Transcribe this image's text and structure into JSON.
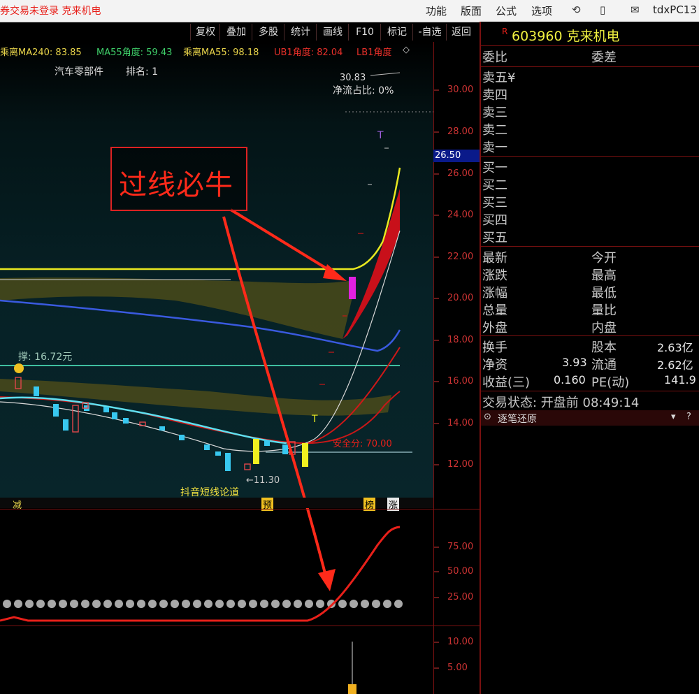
{
  "menubar": {
    "status": "券交易未登录  克来机电",
    "items": [
      "功能",
      "版面",
      "公式",
      "选项"
    ],
    "user": "tdxPC13"
  },
  "toolbar": {
    "buttons": [
      "复权",
      "叠加",
      "多股",
      "统计",
      "画线",
      "F10",
      "标记",
      "-自选",
      "返回"
    ]
  },
  "indicators": {
    "ma240": "乘离MA240: 83.85",
    "ma55_angle": "MA55角度: 59.43",
    "ma55": "乘离MA55: 98.18",
    "ub1": "UB1角度: 82.04",
    "lb1": "LB1角度"
  },
  "chart_info": {
    "sector": "汽车零部件",
    "rank": "排名: 1",
    "net_flow_value": "30.83",
    "net_flow": "净流占比: 0%",
    "support": "撑: 16.72元",
    "safe_score": "安全分: 70.00",
    "low_price": "←11.30",
    "watermark": "抖音短线论道",
    "annotation": "过线必牛",
    "signals": [
      "减",
      "预",
      "榜",
      "涨",
      "T",
      "T"
    ]
  },
  "price_axis": [
    "30.00",
    "28.00",
    "26.00",
    "24.00",
    "22.00",
    "20.00",
    "18.00",
    "16.00",
    "14.00",
    "12.00"
  ],
  "current_price": "26.50",
  "sub_axis1": [
    "75.00",
    "50.00",
    "25.00"
  ],
  "sub_axis2": [
    "10.00",
    "5.00"
  ],
  "quote": {
    "code_name": "603960 克来机电",
    "marker": "R",
    "labels": {
      "weibi": "委比",
      "weicha": "委差",
      "sell": [
        "卖五¥",
        "卖四",
        "卖三",
        "卖二",
        "卖一"
      ],
      "buy": [
        "买一",
        "买二",
        "买三",
        "买四",
        "买五"
      ],
      "zuixin": "最新",
      "jinkai": "今开",
      "zhangdie": "涨跌",
      "zuigao": "最高",
      "zhangfu": "涨幅",
      "zuidi": "最低",
      "zongliang": "总量",
      "liangbi": "量比",
      "waipan": "外盘",
      "neipan": "内盘",
      "huanshou": "换手",
      "guben": "股本",
      "jingzi": "净资",
      "liutong": "流通",
      "shouyi": "收益(三)",
      "pe": "PE(动)"
    },
    "values": {
      "guben": "2.63亿",
      "jingzi": "3.93",
      "liutong": "2.62亿",
      "shouyi": "0.160",
      "pe": "141.9"
    },
    "trade_status": "交易状态: 开盘前 08:49:14",
    "zhubi": "逐笔还原"
  }
}
